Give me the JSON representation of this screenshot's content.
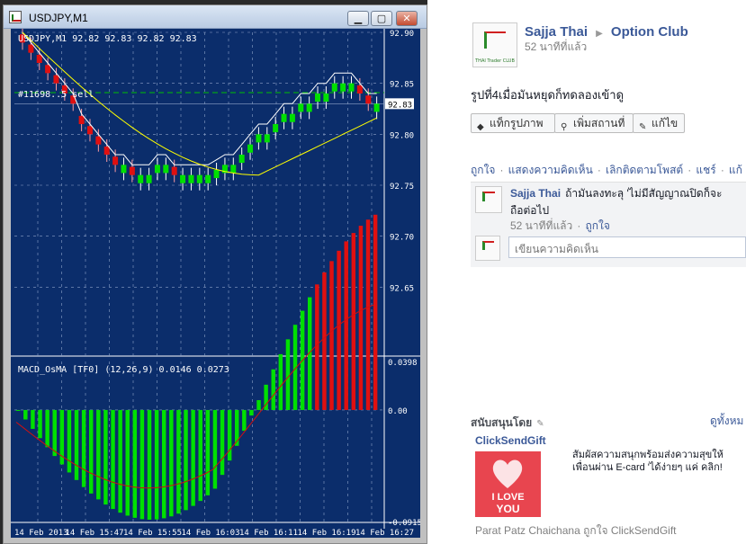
{
  "window": {
    "title": "USDJPY,M1"
  },
  "chart": {
    "main_header": "USDJPY,M1  92.82 92.83 92.82 92.83",
    "order_label": "#11698..5 sell",
    "price_label": "92.83",
    "osc_header": "MACD_OsMA [TF0] (12,26,9)  0.0146 0.0273",
    "colors": {
      "background": "#0b2d6b",
      "bull": "#00e000",
      "bear": "#e01010",
      "ma_fast": "#ffffff",
      "ma_slow": "#ffff00",
      "grid": "#8ea3c8"
    }
  },
  "chart_data": [
    {
      "type": "candlestick",
      "title": "USDJPY,M1",
      "ylim": [
        92.6,
        92.9
      ],
      "y_ticks": [
        "92.90",
        "92.85",
        "92.80",
        "92.75",
        "92.70",
        "92.65"
      ],
      "x_ticks": [
        "14 Feb 2013",
        "14 Feb 15:47",
        "14 Feb 15:55",
        "14 Feb 16:03",
        "14 Feb 16:11",
        "14 Feb 16:19",
        "14 Feb 16:27"
      ],
      "current_price": 92.83
    },
    {
      "type": "bar",
      "title": "MACD_OsMA [TF0] (12,26,9)",
      "values_shown": [
        0.0146,
        0.0273
      ],
      "y_ticks": [
        "0.0398",
        "0.00",
        "-0.0915"
      ],
      "ylim": [
        -0.0915,
        0.0398
      ]
    }
  ],
  "facebook": {
    "post": {
      "author": "Sajja Thai",
      "arrow": "▶",
      "group": "Option Club",
      "time": "52 นาทีที่แล้ว",
      "text": "รูปที่4เมื่อมันหยุดก็ทดลองเข้าดู",
      "avatar_text": "THAI Trader CLUB"
    },
    "actions": [
      {
        "icon": "tag-icon",
        "glyph": "◆",
        "label": "แท็กรูปภาพ"
      },
      {
        "icon": "location-pin-icon",
        "glyph": "⚲",
        "label": "เพิ่มสถานที่"
      },
      {
        "icon": "pencil-icon",
        "glyph": "✎",
        "label": "แก้ไข"
      }
    ],
    "links": {
      "like": "ถูกใจ",
      "comment": "แสดงความคิดเห็น",
      "unfollow": "เลิกติดตามโพสต์",
      "share": "แชร์",
      "edit": "แก้",
      "sep": "·"
    },
    "comment": {
      "author": "Sajja Thai",
      "text_line1": "ถ้ามันลงทะลุ 'ไม่มีสัญญาณปิดก็จะ",
      "text_line2": "ถือต่อไป",
      "time": "52 นาทีที่แล้ว",
      "like": "ถูกใจ"
    },
    "comment_placeholder": "เขียนความคิดเห็น",
    "sponsored": {
      "heading": "สนับสนุนโดย",
      "see_all": "ดูทั้งหม",
      "ad_title": "ClickSendGift",
      "ad_text_line1": "สัมผัสความสนุกพร้อมส่งความสุขให้",
      "ad_text_line2": "เพื่อนผ่าน E-card 'ได้ง่ายๆ แค่ คลิก!",
      "img_text_1": "I LOVE",
      "img_text_2": "YOU",
      "social": "Parat Patz Chaichana ถูกใจ ClickSendGift"
    }
  }
}
